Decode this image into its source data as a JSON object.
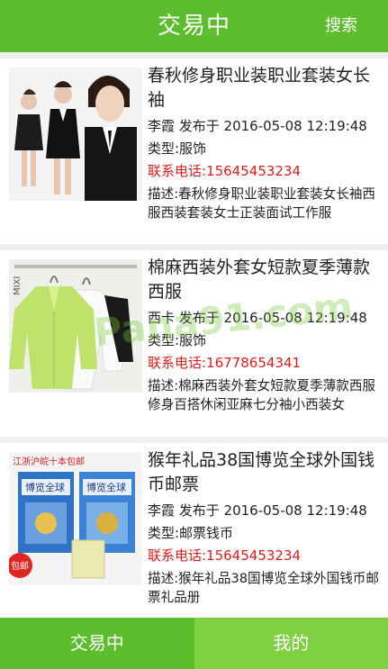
{
  "header": {
    "title": "交易中",
    "search_label": "搜索"
  },
  "items": [
    {
      "title": "春秋修身职业装职业套装女长袖",
      "meta": "李霞 发布于 2016-05-08 12:19:48",
      "category": "类型:服饰",
      "phone": "联系电话:15645453234",
      "desc": "描述:春秋修身职业装职业套装女长袖西服西装套装女士正装面试工作服"
    },
    {
      "title": "棉麻西装外套女短款夏季薄款西服",
      "meta": "西卡 发布于 2016-05-08 12:19:48",
      "category": "类型:服饰",
      "phone": "联系电话:16778654341",
      "desc": "描述:棉麻西装外套女短款夏季薄款西服修身百搭休闲亚麻七分袖小西装女"
    },
    {
      "title": "猴年礼品38国博览全球外国钱币邮票",
      "meta": "李霞 发布于 2016-05-08 12:19:48",
      "category": "类型:邮票钱币",
      "phone": "联系电话:15645453234",
      "desc": "描述:猴年礼品38国博览全球外国钱币邮票礼品册"
    }
  ],
  "thumbs": {
    "mixi": "MIXI",
    "stamps_banner": "江浙沪皖十本包邮",
    "stamps_book": "博览全球",
    "baoyou": "包邮"
  },
  "watermark": "Pana91.com",
  "footer": {
    "tab_trading": "交易中",
    "tab_mine": "我的"
  },
  "colors": {
    "green": "#5cbd2d",
    "green_light": "#7dd03f",
    "phone_red": "#e11b1b"
  }
}
